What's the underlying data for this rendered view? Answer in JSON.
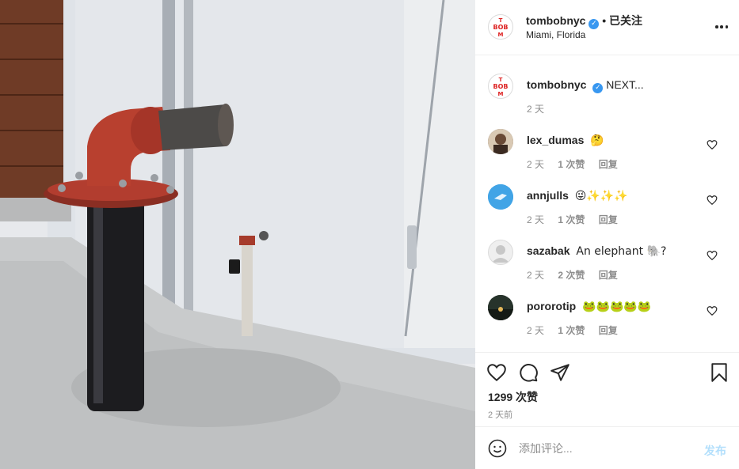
{
  "post": {
    "author": "tombobnyc",
    "follow_status": "• 已关注",
    "location": "Miami, Florida",
    "caption_author": "tombobnyc",
    "caption_text": "NEXT...",
    "caption_time": "2 天",
    "avatar_letters": [
      "T",
      "BOB",
      "M"
    ]
  },
  "comments": [
    {
      "user": "lex_dumas",
      "text": "🤔",
      "time": "2 天",
      "likes": "1 次赞",
      "reply": "回复",
      "avatar": "photo-dark"
    },
    {
      "user": "annjulls",
      "text": "😜✨✨✨",
      "time": "2 天",
      "likes": "1 次赞",
      "reply": "回复",
      "avatar": "blue-bird"
    },
    {
      "user": "sazabak",
      "text": "An elephant 🐘?",
      "time": "2 天",
      "likes": "2 次赞",
      "reply": "回复",
      "avatar": "default-user"
    },
    {
      "user": "pororotip",
      "text": "🐸🐸🐸🐸🐸",
      "time": "2 天",
      "likes": "1 次赞",
      "reply": "回复",
      "avatar": "dark-landscape"
    }
  ],
  "actions": {
    "likes_count": "1299 次赞",
    "posted_ago": "2 天前"
  },
  "add_comment": {
    "placeholder": "添加评论...",
    "post_label": "发布"
  },
  "colors": {
    "verified": "#3897f0",
    "post_button_disabled": "#b2dffc",
    "secondary_text": "#8e8e8e"
  }
}
